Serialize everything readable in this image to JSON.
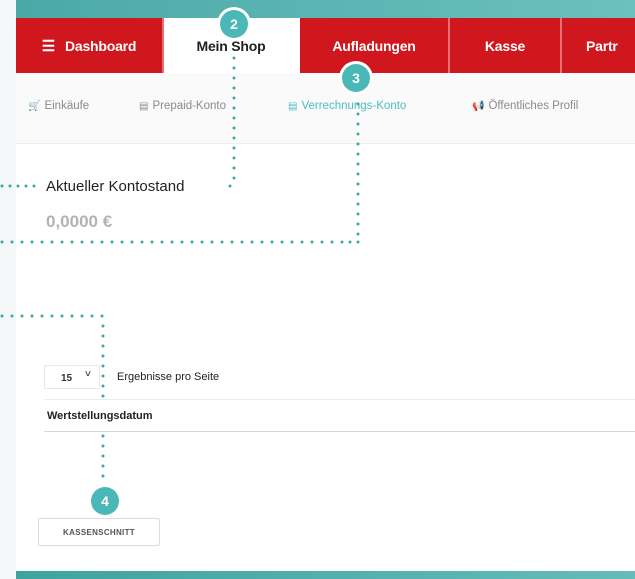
{
  "nav": {
    "dashboard_label": "Dashboard",
    "mein_shop_label": "Mein Shop",
    "aufladungen_label": "Aufladungen",
    "kasse_label": "Kasse",
    "partner_label": "Partr"
  },
  "subnav": {
    "einkaeufe_label": "Einkäufe",
    "prepaid_label": "Prepaid-Konto",
    "verrechnungs_label": "Verrechnungs-Konto",
    "profil_label": "Öffentliches Profil"
  },
  "balance": {
    "title": "Aktueller Kontostand",
    "value": "0,0000 €"
  },
  "table": {
    "page_size": "15",
    "per_page_label": "Ergebnisse pro Seite",
    "column_header": "Wertstellungsdatum"
  },
  "actions": {
    "kassenschnitt_label": "KASSENSCHNITT"
  },
  "badges": {
    "b2": "2",
    "b3": "3",
    "b4": "4"
  },
  "colors": {
    "nav_red": "#d0171d",
    "accent_teal": "#4ab8b6",
    "active_sub": "#4bbfbf"
  }
}
